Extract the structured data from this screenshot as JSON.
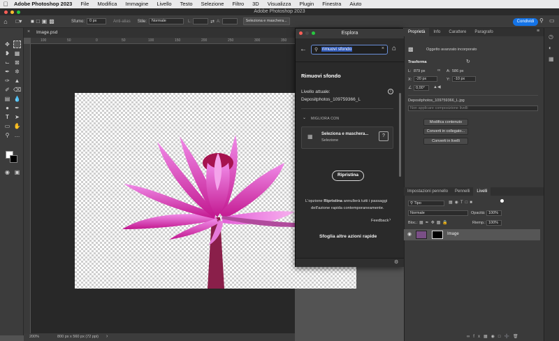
{
  "menubar": {
    "app_name": "Adobe Photoshop 2023",
    "items": [
      "File",
      "Modifica",
      "Immagine",
      "Livello",
      "Testo",
      "Selezione",
      "Filtro",
      "3D",
      "Visualizza",
      "Plugin",
      "Finestra",
      "Aiuto"
    ]
  },
  "window": {
    "title": "Adobe Photoshop 2023"
  },
  "options_bar": {
    "sfumo_label": "Sfumo:",
    "sfumo_value": "0 px",
    "antialias_label": "Anti-alias",
    "stile_label": "Stile:",
    "stile_value": "Normale",
    "l_label": "L:",
    "a_label": "A:",
    "select_mask_label": "Seleziona e maschera...",
    "share_label": "Condividi"
  },
  "document": {
    "tab_title": "Image.psd",
    "zoom": "200%",
    "status": "800 px x 560 px (72 ppi)",
    "ruler_ticks": [
      "100",
      "50",
      "0",
      "50",
      "100",
      "150",
      "200",
      "250",
      "300",
      "350"
    ]
  },
  "explore_dialog": {
    "title": "Esplora",
    "search_value": "rimuovi sfondo",
    "heading": "Rimuovi sfondo",
    "current_layer_label": "Livello attuale:",
    "current_layer_value": "Depositphotos_109759366_L",
    "improve_with": "MIGLIORA CON",
    "card_title": "Seleziona e maschera...",
    "card_subtitle": "Selezione",
    "reset_button": "Ripristina",
    "info_prefix": "L'opzione ",
    "info_bold": "Ripristina",
    "info_suffix": " annullerà tutti i passaggi",
    "info_line2": "dell'azione rapida contemporaneamente.",
    "feedback": "Feedback",
    "browse": "Sfoglia altre azioni rapide"
  },
  "properties_panel": {
    "tabs": [
      "Proprietà",
      "Info",
      "Carattere",
      "Paragrafo"
    ],
    "object_type": "Oggetto avanzato incorporato",
    "section_transform": "Trasforma",
    "l_label": "L:",
    "l_value": "879 px",
    "a_label": "A:",
    "a_value": "586 px",
    "x_label": "X:",
    "x_value": "-20 px",
    "y_label": "Y:",
    "y_value": "-10 px",
    "angle_value": "0,00°",
    "file_name": "Depositphotos_109759366_L.jpg",
    "comp_placeholder": "Non applicare composizione livelli",
    "btn_edit": "Modifica contenuto",
    "btn_convert_linked": "Converti in collegato...",
    "btn_convert_layers": "Converti in livelli"
  },
  "layers_panel": {
    "tabs": [
      "Impostazioni pennello",
      "Pennelli",
      "Livelli"
    ],
    "filter_value": "Tipo",
    "blend_value": "Normale",
    "opacity_label": "Opacità:",
    "opacity_value": "100%",
    "lock_label": "Bloc.:",
    "fill_label": "Riemp.:",
    "fill_value": "100%",
    "layer_name": "Image"
  },
  "colors": {
    "accent": "#1473e6",
    "flower": "#d63fc8"
  }
}
